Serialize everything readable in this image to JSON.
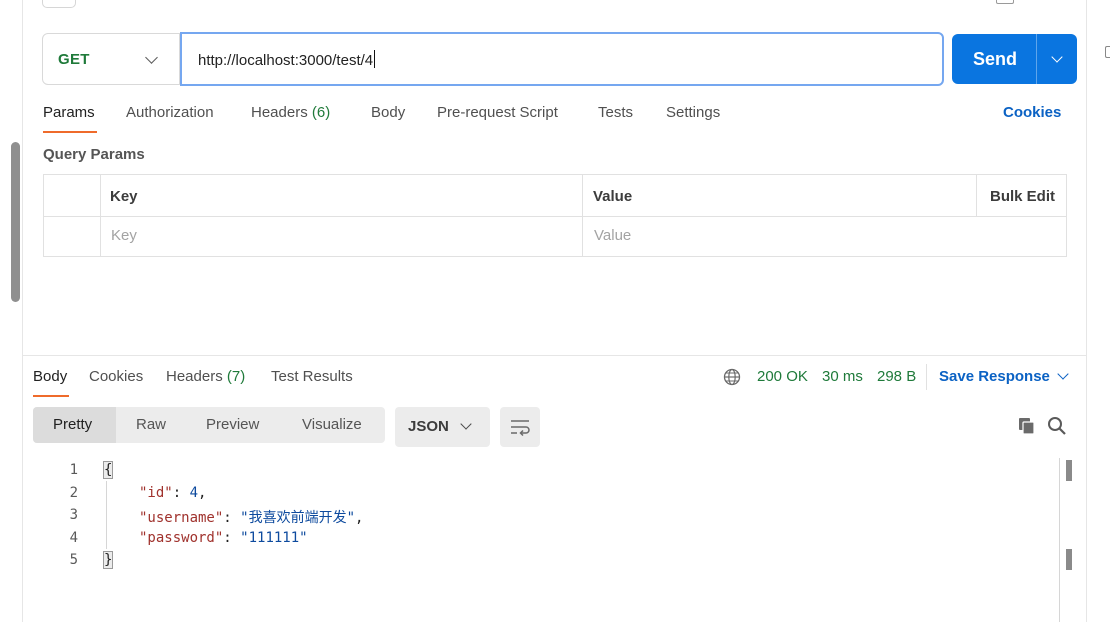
{
  "request": {
    "method": "GET",
    "url": "http://localhost:3000/test/4",
    "send_label": "Send"
  },
  "request_tabs": [
    {
      "label": "Params"
    },
    {
      "label": "Authorization"
    },
    {
      "label": "Headers",
      "count": "(6)"
    },
    {
      "label": "Body"
    },
    {
      "label": "Pre-request Script"
    },
    {
      "label": "Tests"
    },
    {
      "label": "Settings"
    }
  ],
  "cookies_link": "Cookies",
  "query_params": {
    "title": "Query Params",
    "key_header": "Key",
    "value_header": "Value",
    "bulk_edit": "Bulk Edit",
    "key_placeholder": "Key",
    "value_placeholder": "Value"
  },
  "response_tabs": [
    {
      "label": "Body"
    },
    {
      "label": "Cookies"
    },
    {
      "label": "Headers",
      "count": "(7)"
    },
    {
      "label": "Test Results"
    }
  ],
  "response_status": {
    "code": "200 OK",
    "time": "30 ms",
    "size": "298 B"
  },
  "save_response": "Save Response",
  "view_modes": [
    "Pretty",
    "Raw",
    "Preview",
    "Visualize"
  ],
  "format": "JSON",
  "code": {
    "line_numbers": [
      "1",
      "2",
      "3",
      "4",
      "5"
    ],
    "open_brace": "{",
    "close_brace": "}",
    "rows": [
      {
        "key": "\"id\"",
        "sep": ": ",
        "value": "4",
        "trail": ","
      },
      {
        "key": "\"username\"",
        "sep": ": ",
        "value": "\"我喜欢前端开发\"",
        "trail": ","
      },
      {
        "key": "\"password\"",
        "sep": ": ",
        "value": "\"111111\"",
        "trail": ""
      }
    ]
  }
}
